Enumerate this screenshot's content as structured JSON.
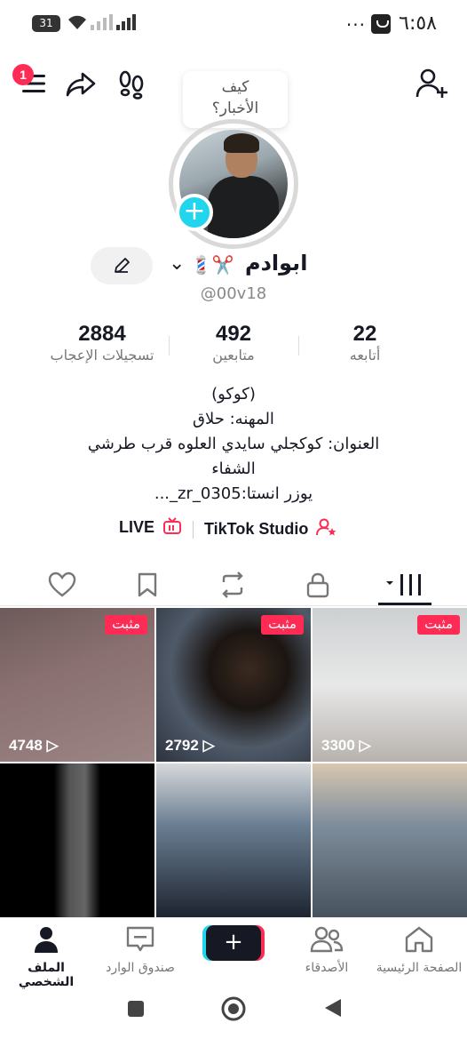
{
  "status_bar": {
    "time": "٦:٥٨",
    "battery": "31",
    "more": "..."
  },
  "header": {
    "notification_count": "1",
    "greeting_bubble": [
      "كيف",
      "الأخبار؟"
    ]
  },
  "profile": {
    "display_name": "ابوادم",
    "name_emoji": "💈✂️",
    "handle": "@00v18",
    "stats": [
      {
        "value": "22",
        "label": "أتابعه"
      },
      {
        "value": "492",
        "label": "متابعين"
      },
      {
        "value": "2884",
        "label": "تسجيلات الإعجاب"
      }
    ],
    "bio": [
      "(كوكو)",
      "المهنه: حلاق",
      "العنوان: كوكجلي سايدي العلوه قرب طرشي",
      "الشفاء",
      "يوزر انستا:zr_0305_..."
    ],
    "links": {
      "studio": "TikTok Studio",
      "live": "LIVE"
    }
  },
  "videos": [
    {
      "pinned_label": "مثبت",
      "views": "3300"
    },
    {
      "pinned_label": "مثبت",
      "views": "2792"
    },
    {
      "pinned_label": "مثبت",
      "views": "4748"
    },
    {
      "pinned_label": "",
      "views": ""
    },
    {
      "pinned_label": "",
      "views": ""
    },
    {
      "pinned_label": "",
      "views": ""
    }
  ],
  "bottom_nav": [
    {
      "label": "الصفحة الرئيسية",
      "icon": "home-icon"
    },
    {
      "label": "الأصدقاء",
      "icon": "friends-icon"
    },
    {
      "label": "",
      "icon": "create-icon"
    },
    {
      "label": "صندوق الوارد",
      "icon": "inbox-icon"
    },
    {
      "label": "الملف الشخصي",
      "icon": "profile-icon"
    }
  ],
  "colors": {
    "accent": "#fe2c55",
    "cyan": "#20d5ec",
    "text": "#161823"
  }
}
